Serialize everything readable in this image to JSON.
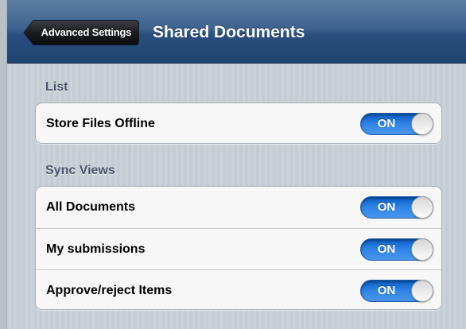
{
  "navbar": {
    "back_label": "Advanced Settings",
    "title": "Shared Documents"
  },
  "sections": {
    "list": {
      "header": "List",
      "rows": [
        {
          "label": "Store Files Offline",
          "toggle": "ON"
        }
      ]
    },
    "sync_views": {
      "header": "Sync Views",
      "rows": [
        {
          "label": "All Documents",
          "toggle": "ON"
        },
        {
          "label": "My submissions",
          "toggle": "ON"
        },
        {
          "label": "Approve/reject Items",
          "toggle": "ON"
        }
      ]
    }
  },
  "colors": {
    "navbar": "#2a4f7e",
    "toggle_on": "#2f84e6",
    "section_header": "#4c566c"
  }
}
